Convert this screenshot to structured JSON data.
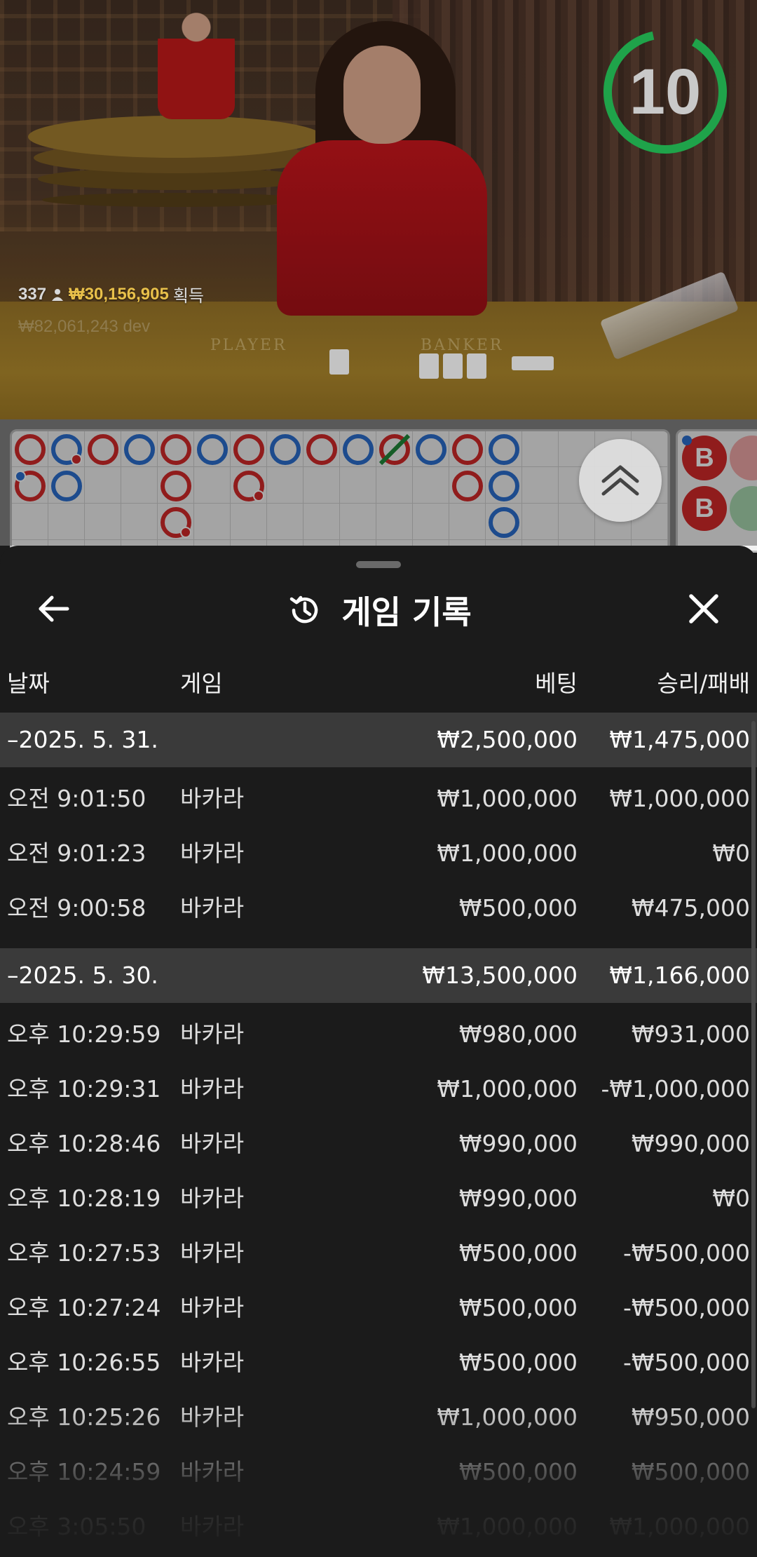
{
  "video": {
    "countdown": "10",
    "stats": {
      "players": "337",
      "amount": "₩30,156,905",
      "won_label": "획득"
    },
    "stats_ghost": "₩82,061,243 dev",
    "felt_player": "PLAYER",
    "felt_banker": "BANKER"
  },
  "roadmap": {
    "bead_colors": {
      "banker": "#d42a2a",
      "player": "#2b6fd0",
      "tie": "#1f8a3a"
    },
    "big_road_labels": [
      "B",
      "B"
    ]
  },
  "sheet": {
    "title": "게임 기록",
    "headers": {
      "date": "날짜",
      "game": "게임",
      "bet": "베팅",
      "result": "승리/패배"
    },
    "groups": [
      {
        "date": "–2025. 5. 31.",
        "bet_total": "₩2,500,000",
        "result_total": "₩1,475,000",
        "rows": [
          {
            "time": "오전 9:01:50",
            "game": "바카라",
            "bet": "₩1,000,000",
            "result": "₩1,000,000"
          },
          {
            "time": "오전 9:01:23",
            "game": "바카라",
            "bet": "₩1,000,000",
            "result": "₩0"
          },
          {
            "time": "오전 9:00:58",
            "game": "바카라",
            "bet": "₩500,000",
            "result": "₩475,000"
          }
        ]
      },
      {
        "date": "–2025. 5. 30.",
        "bet_total": "₩13,500,000",
        "result_total": "₩1,166,000",
        "rows": [
          {
            "time": "오후 10:29:59",
            "game": "바카라",
            "bet": "₩980,000",
            "result": "₩931,000"
          },
          {
            "time": "오후 10:29:31",
            "game": "바카라",
            "bet": "₩1,000,000",
            "result": "-₩1,000,000"
          },
          {
            "time": "오후 10:28:46",
            "game": "바카라",
            "bet": "₩990,000",
            "result": "₩990,000"
          },
          {
            "time": "오후 10:28:19",
            "game": "바카라",
            "bet": "₩990,000",
            "result": "₩0"
          },
          {
            "time": "오후 10:27:53",
            "game": "바카라",
            "bet": "₩500,000",
            "result": "-₩500,000"
          },
          {
            "time": "오후 10:27:24",
            "game": "바카라",
            "bet": "₩500,000",
            "result": "-₩500,000"
          },
          {
            "time": "오후 10:26:55",
            "game": "바카라",
            "bet": "₩500,000",
            "result": "-₩500,000"
          },
          {
            "time": "오후 10:25:26",
            "game": "바카라",
            "bet": "₩1,000,000",
            "result": "₩950,000"
          },
          {
            "time": "오후 10:24:59",
            "game": "바카라",
            "bet": "₩500,000",
            "result": "₩500,000"
          },
          {
            "time": "오후 3:05:50",
            "game": "바카라",
            "bet": "₩1,000,000",
            "result": "₩1,000,000"
          }
        ]
      }
    ]
  }
}
